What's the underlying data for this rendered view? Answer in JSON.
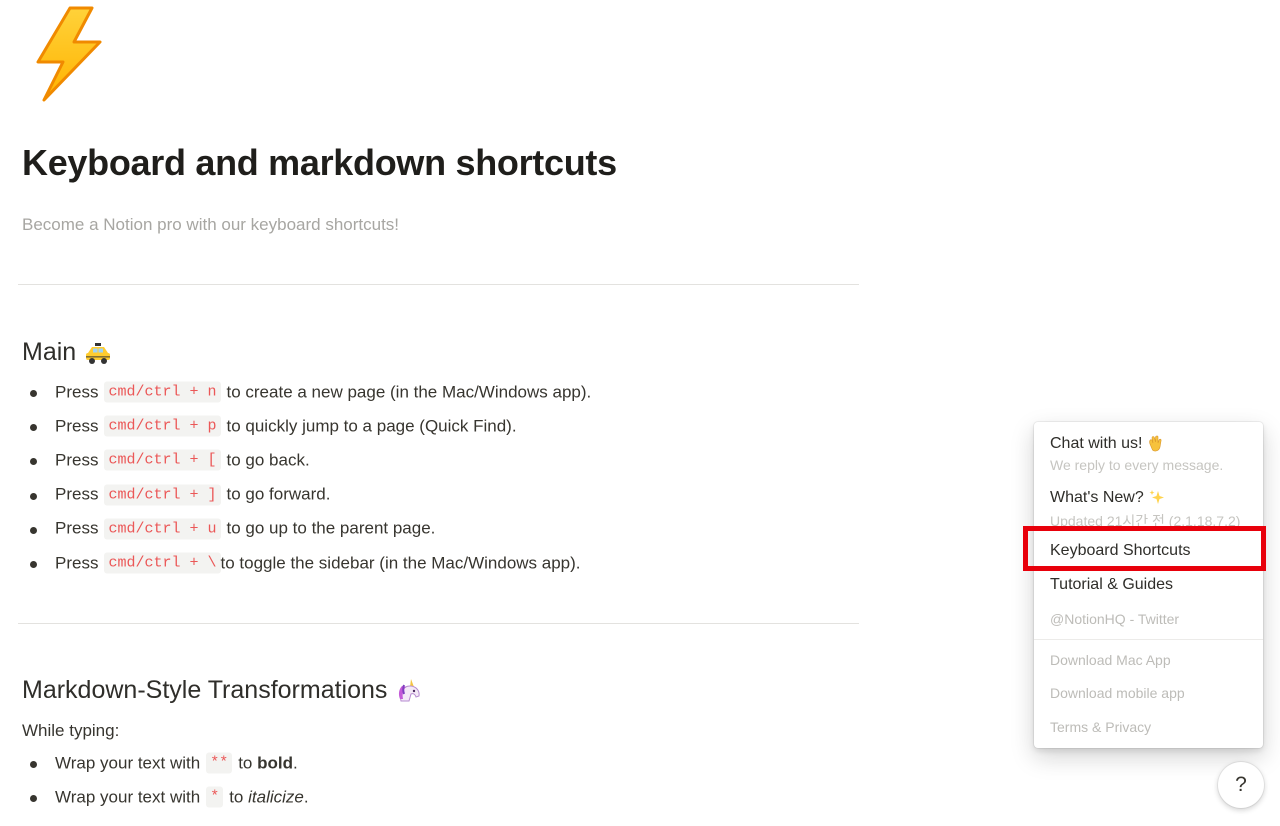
{
  "page": {
    "icon": "lightning-bolt-icon",
    "title": "Keyboard and markdown shortcuts",
    "subtitle": "Become a Notion pro with our keyboard shortcuts!"
  },
  "main_section": {
    "heading": "Main",
    "heading_icon": "taxi-icon",
    "items": [
      {
        "prefix": "Press",
        "code": "cmd/ctrl + n",
        "suffix": "to create a new page (in the Mac/Windows app)."
      },
      {
        "prefix": "Press",
        "code": "cmd/ctrl + p",
        "suffix": "to quickly jump to a page (Quick Find)."
      },
      {
        "prefix": "Press",
        "code": "cmd/ctrl + [",
        "suffix": "to go back."
      },
      {
        "prefix": "Press",
        "code": "cmd/ctrl + ]",
        "suffix": "to go forward."
      },
      {
        "prefix": "Press",
        "code": "cmd/ctrl + u",
        "suffix": "to go up to the parent page."
      },
      {
        "prefix": "Press",
        "code": "cmd/ctrl + \\",
        "suffix": "to toggle the sidebar (in the Mac/Windows app)."
      }
    ]
  },
  "markdown_section": {
    "heading": "Markdown-Style Transformations",
    "heading_icon": "unicorn-icon",
    "intro": "While typing:",
    "items": [
      {
        "prefix": "Wrap your text with",
        "code": "**",
        "pre": "to",
        "styled": "bold",
        "post": "."
      },
      {
        "prefix": "Wrap your text with",
        "code": "*",
        "pre": "to",
        "styled": "italicize",
        "post": "."
      }
    ]
  },
  "help_menu": {
    "chat": {
      "title": "Chat with us!",
      "icon": "waving-hand-icon",
      "subtitle": "We reply to every message."
    },
    "whats_new": {
      "title": "What's New?",
      "icon": "sparkles-icon",
      "subtitle": "Updated 21시간 전 (2.1.18.7.2)"
    },
    "keyboard_shortcuts": "Keyboard Shortcuts",
    "tutorial": "Tutorial & Guides",
    "twitter": "@NotionHQ - Twitter",
    "download_mac": "Download Mac App",
    "download_mobile": "Download mobile app",
    "terms": "Terms & Privacy"
  },
  "help_button": {
    "label": "?"
  },
  "colors": {
    "code_text": "#eb5757",
    "highlight_border": "#e8000b",
    "muted_text": "#a7a6a2"
  }
}
